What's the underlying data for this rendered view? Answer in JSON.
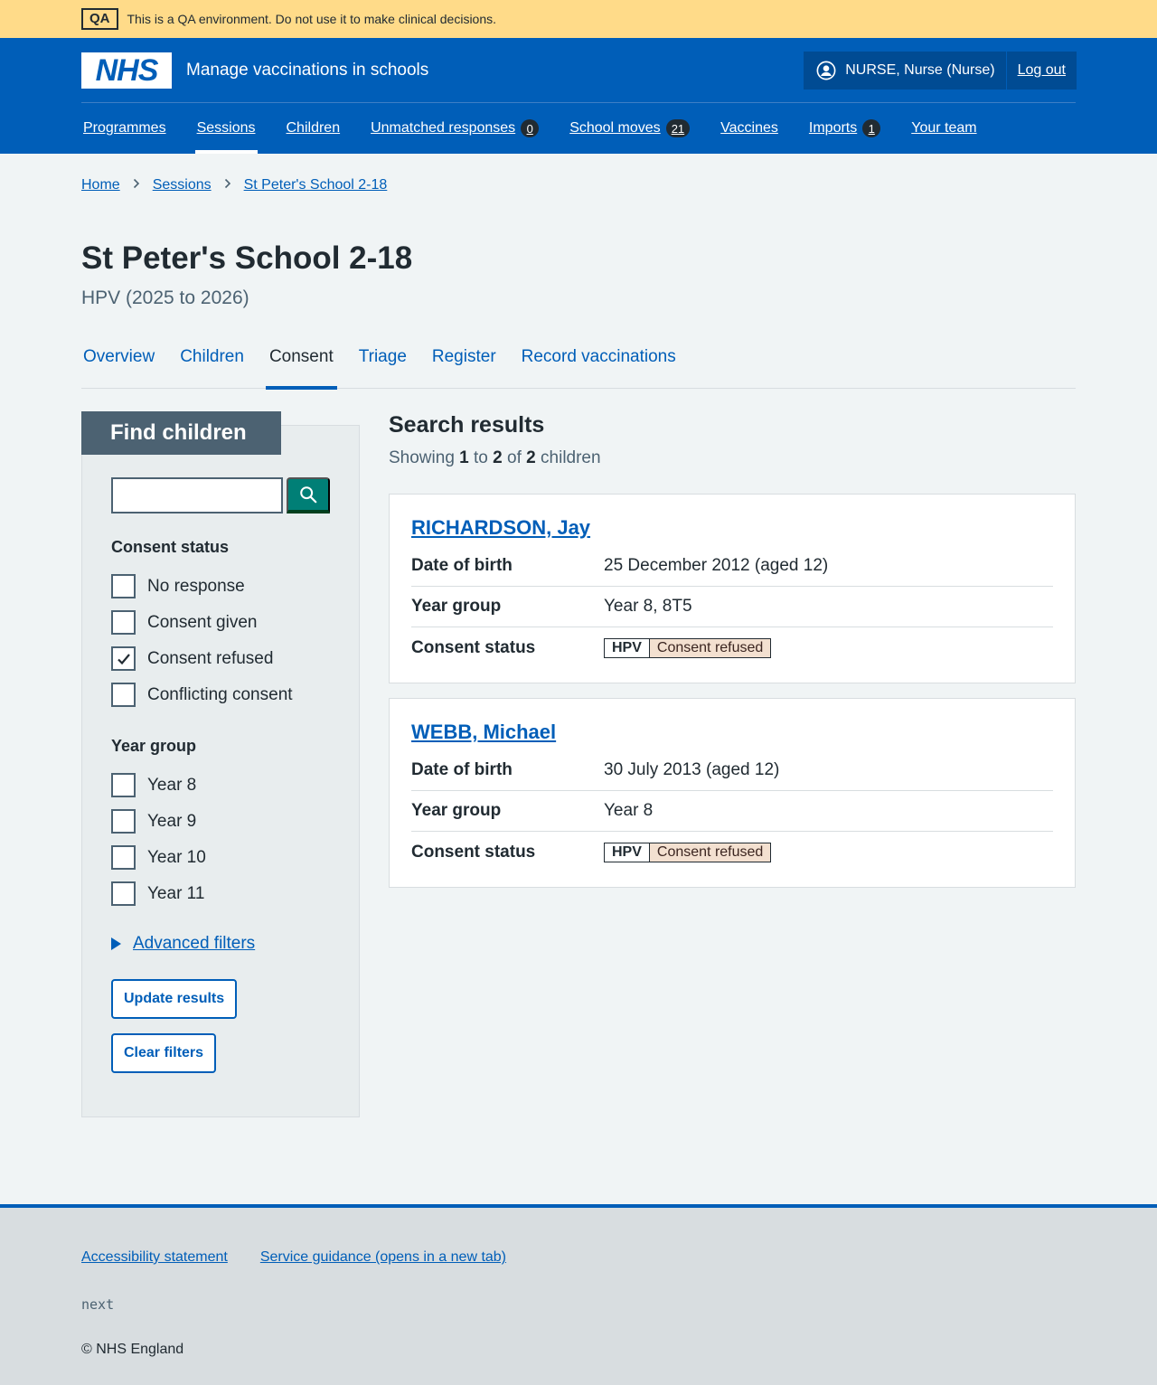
{
  "qa_banner": {
    "tag": "QA",
    "message": "This is a QA environment. Do not use it to make clinical decisions."
  },
  "header": {
    "logo": "NHS",
    "service_name": "Manage vaccinations in schools",
    "user": "NURSE, Nurse (Nurse)",
    "logout": "Log out"
  },
  "nav": [
    {
      "label": "Programmes"
    },
    {
      "label": "Sessions",
      "active": true
    },
    {
      "label": "Children"
    },
    {
      "label": "Unmatched responses",
      "count": "0"
    },
    {
      "label": "School moves",
      "count": "21"
    },
    {
      "label": "Vaccines"
    },
    {
      "label": "Imports",
      "count": "1"
    },
    {
      "label": "Your team"
    }
  ],
  "breadcrumb": [
    "Home",
    "Sessions",
    "St Peter's School 2-18"
  ],
  "page": {
    "title": "St Peter's School 2-18",
    "subtitle": "HPV (2025 to 2026)"
  },
  "tabs": [
    "Overview",
    "Children",
    "Consent",
    "Triage",
    "Register",
    "Record vaccinations"
  ],
  "active_tab": "Consent",
  "filter": {
    "heading": "Find children",
    "search_value": "",
    "consent_label": "Consent status",
    "consent_options": [
      {
        "label": "No response",
        "checked": false
      },
      {
        "label": "Consent given",
        "checked": false
      },
      {
        "label": "Consent refused",
        "checked": true
      },
      {
        "label": "Conflicting consent",
        "checked": false
      }
    ],
    "year_label": "Year group",
    "year_options": [
      {
        "label": "Year 8",
        "checked": false
      },
      {
        "label": "Year 9",
        "checked": false
      },
      {
        "label": "Year 10",
        "checked": false
      },
      {
        "label": "Year 11",
        "checked": false
      }
    ],
    "advanced": "Advanced filters",
    "update_button": "Update results",
    "clear_button": "Clear filters"
  },
  "results": {
    "title": "Search results",
    "count_prefix": "Showing",
    "from": "1",
    "to_word": "to",
    "to": "2",
    "of_word": "of",
    "total": "2",
    "suffix": "children",
    "labels": {
      "dob": "Date of birth",
      "year": "Year group",
      "consent": "Consent status"
    },
    "children": [
      {
        "name": "RICHARDSON, Jay",
        "dob": "25 December 2012 (aged 12)",
        "year": "Year 8, 8T5",
        "programme": "HPV",
        "status": "Consent refused"
      },
      {
        "name": "WEBB, Michael",
        "dob": "30 July 2013 (aged 12)",
        "year": "Year 8",
        "programme": "HPV",
        "status": "Consent refused"
      }
    ]
  },
  "footer": {
    "links": [
      "Accessibility statement",
      "Service guidance (opens in a new tab)"
    ],
    "version": "next",
    "copyright": "© NHS England"
  },
  "colors": {
    "nhs_blue": "#005eb8",
    "qa_yellow": "#ffdb89",
    "search_green": "#007f76",
    "refused_bg": "#f3e0d0"
  }
}
